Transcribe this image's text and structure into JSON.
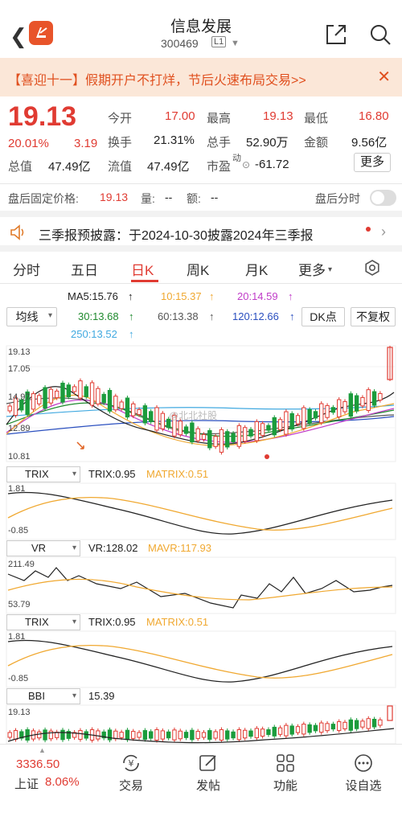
{
  "header": {
    "title": "信息发展",
    "code": "300469",
    "level": "L1"
  },
  "banner": {
    "text": "【喜迎十一】假期开户不打烊，节后火速布局交易>>"
  },
  "quote": {
    "price": "19.13",
    "change_pct": "20.01%",
    "change": "3.19",
    "open_label": "今开",
    "open": "17.00",
    "high_label": "最高",
    "high": "19.13",
    "low_label": "最低",
    "low": "16.80",
    "turnover_label": "换手",
    "turnover": "21.31%",
    "volume_label": "总手",
    "volume": "52.90万",
    "amount_label": "金额",
    "amount": "9.56亿",
    "mktcap_label": "总值",
    "mktcap": "47.49亿",
    "float_label": "流值",
    "float": "47.49亿",
    "pe_label": "市盈",
    "pe_sup": "动",
    "pe": "-61.72",
    "more_label": "更多"
  },
  "after_hours": {
    "label": "盘后固定价格:",
    "price": "19.13",
    "qty_label": "量:",
    "qty": "--",
    "amt_label": "额:",
    "amt": "--",
    "chart_label": "盘后分时"
  },
  "notice": {
    "text": "三季报预披露：于2024-10-30披露2024年三季报"
  },
  "tabs": [
    "分时",
    "五日",
    "日K",
    "周K",
    "月K",
    "更多"
  ],
  "active_tab": "日K",
  "ma": {
    "ma5": "MA5:15.76",
    "ma10": "10:15.37",
    "ma20": "20:14.59",
    "ma30": "30:13.68",
    "ma60": "60:13.38",
    "ma120": "120:12.66",
    "ma250": "250:13.52"
  },
  "controls": {
    "line_select": "均线",
    "dk": "DK点",
    "adjust": "不复权"
  },
  "kline": {
    "y_high": "19.13",
    "y_2": "17.05",
    "y_3": "14.97",
    "y_4": "12.89",
    "y_low": "10.81",
    "watermark": "@北北社股"
  },
  "trix1": {
    "select": "TRIX",
    "value": "TRIX:0.95",
    "matrix": "MATRIX:0.51",
    "y_high": "1.81",
    "y_low": "-0.85"
  },
  "vr": {
    "select": "VR",
    "value": "VR:128.02",
    "mavr": "MAVR:117.93",
    "y_high": "211.49",
    "y_low": "53.79"
  },
  "trix2": {
    "select": "TRIX",
    "value": "TRIX:0.95",
    "matrix": "MATRIX:0.51",
    "y_high": "1.81",
    "y_low": "-0.85"
  },
  "bbi": {
    "select": "BBI",
    "value": "15.39",
    "y_high": "19.13"
  },
  "bottom": {
    "index_value": "3336.50",
    "index_name": "上证",
    "index_change": "8.06%",
    "trade": "交易",
    "post": "发帖",
    "func": "功能",
    "watchlist": "设自选"
  },
  "colors": {
    "up": "#e03b32",
    "down": "#1b9c3c",
    "ma5": "#222222",
    "ma10": "#f0a830",
    "ma20": "#c03cc8",
    "ma30": "#1f8a2e",
    "ma60": "#555555",
    "ma120": "#2a4fbf",
    "ma250": "#41a9e0"
  }
}
